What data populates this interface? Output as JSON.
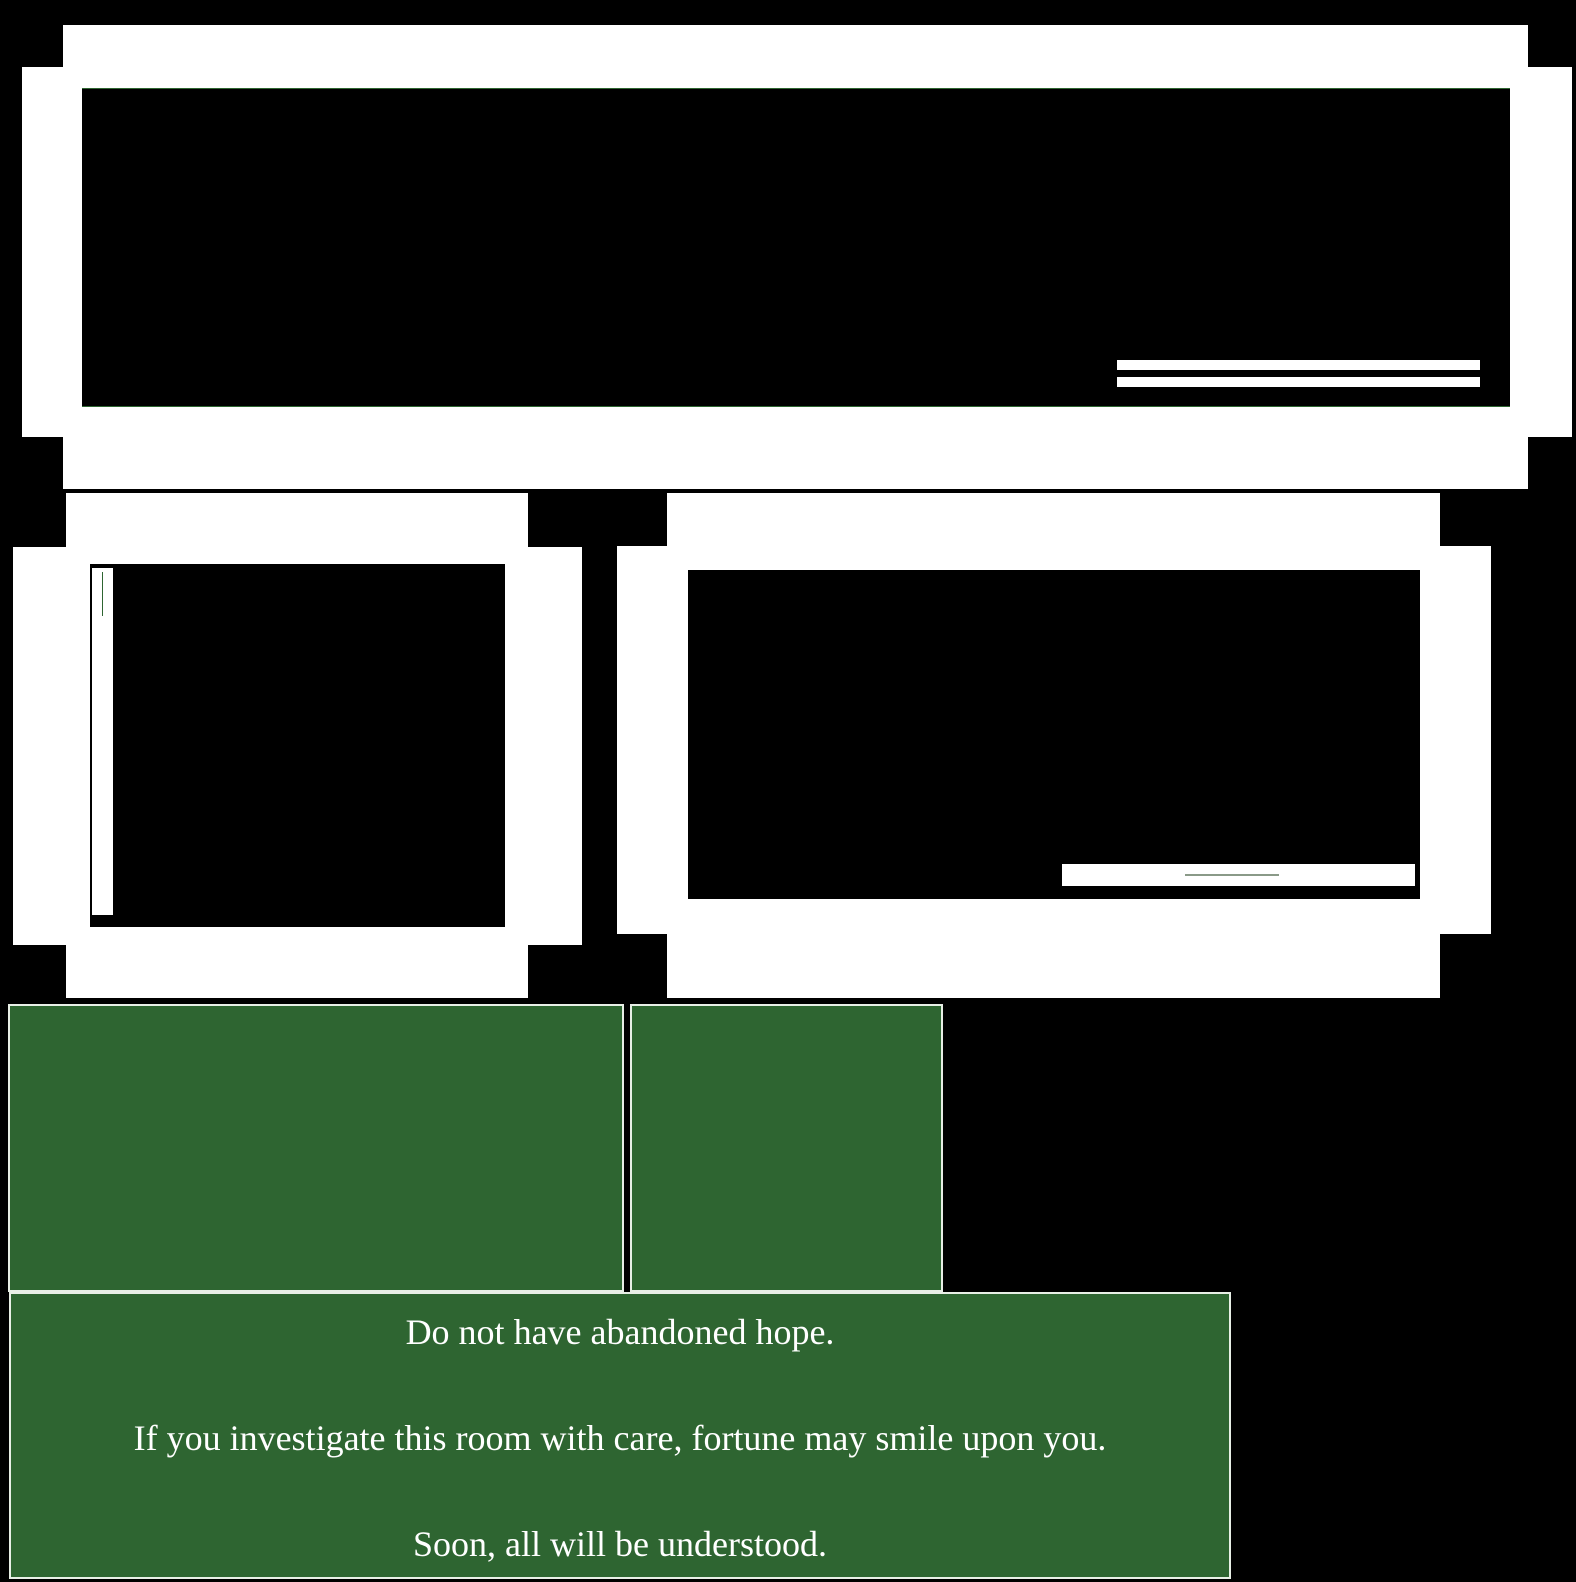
{
  "theme": {
    "background": "#000000",
    "frame": "#ffffff",
    "panel_green": "#2e6531",
    "panel_border": "#e8efe6",
    "text": "#ffffff"
  },
  "dialogue": {
    "lines": [
      "Do not have abandoned hope.",
      "If you investigate this room with care, fortune may smile upon you.",
      "Soon, all will be understood."
    ]
  }
}
